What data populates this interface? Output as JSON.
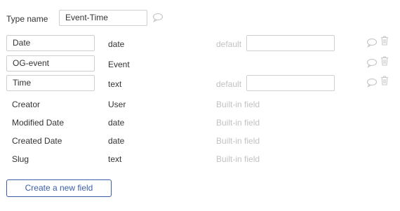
{
  "type_name": {
    "label": "Type name",
    "value": "Event-Time"
  },
  "fields": [
    {
      "name": "Date",
      "type": "date",
      "default_label": "default",
      "default_value": "",
      "editable": true,
      "deletable": true
    },
    {
      "name": "OG-event",
      "type": "Event",
      "default_label": "",
      "default_value": "",
      "editable": true,
      "deletable": true
    },
    {
      "name": "Time",
      "type": "text",
      "default_label": "default",
      "default_value": "",
      "editable": true,
      "deletable": true
    }
  ],
  "builtin_fields": [
    {
      "name": "Creator",
      "type": "User",
      "note": "Built-in field"
    },
    {
      "name": "Modified Date",
      "type": "date",
      "note": "Built-in field"
    },
    {
      "name": "Created Date",
      "type": "date",
      "note": "Built-in field"
    },
    {
      "name": "Slug",
      "type": "text",
      "note": "Built-in field"
    }
  ],
  "create_button_label": "Create a new field",
  "icons": {
    "comment": "comment-icon",
    "trash": "trash-icon"
  }
}
